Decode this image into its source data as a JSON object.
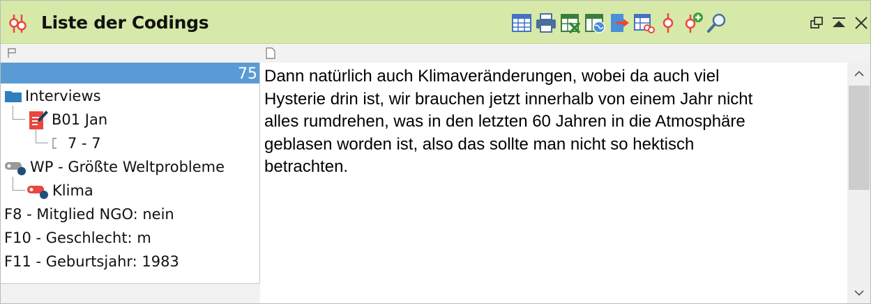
{
  "window": {
    "title": "Liste der Codings"
  },
  "toolbar": {
    "buttons": [
      {
        "icon": "table-icon",
        "name": "table-view-button"
      },
      {
        "icon": "printer-icon",
        "name": "print-button"
      },
      {
        "icon": "excel-export-icon",
        "name": "export-excel-button"
      },
      {
        "icon": "web-export-icon",
        "name": "export-html-button"
      },
      {
        "icon": "document-export-icon",
        "name": "export-document-button"
      },
      {
        "icon": "table-codings-icon",
        "name": "table-codings-button"
      },
      {
        "icon": "coding-icon",
        "name": "coding-button"
      },
      {
        "icon": "coding-add-icon",
        "name": "add-coding-button"
      },
      {
        "icon": "search-icon",
        "name": "search-button"
      }
    ]
  },
  "left_panel": {
    "selected_count": "75",
    "tree": {
      "document_group": "Interviews",
      "document": "B01 Jan",
      "segment": "7 - 7",
      "code_parent": "WP - Größte Weltprobleme",
      "code_child": "Klima",
      "variables": [
        "F8 - Mitglied NGO: nein",
        "F10 - Geschlecht: m",
        "F11 - Geburtsjahr: 1983"
      ]
    }
  },
  "right_panel": {
    "lines": [
      "Dann natürlich auch Klimaveränderungen, wobei da auch viel",
      "Hysterie drin ist, wir brauchen jetzt innerhalb von einem Jahr nicht",
      "alles rumdrehen, was in den letzten 60 Jahren in die Atmosphäre",
      "geblasen worden ist, also das sollte man nicht so hektisch",
      "betrachten."
    ]
  },
  "colors": {
    "titlebar": "#d6e9a8",
    "selection": "#5b9bd5",
    "coding_red": "#e8473e",
    "code_dot_blue": "#1f4e79"
  }
}
